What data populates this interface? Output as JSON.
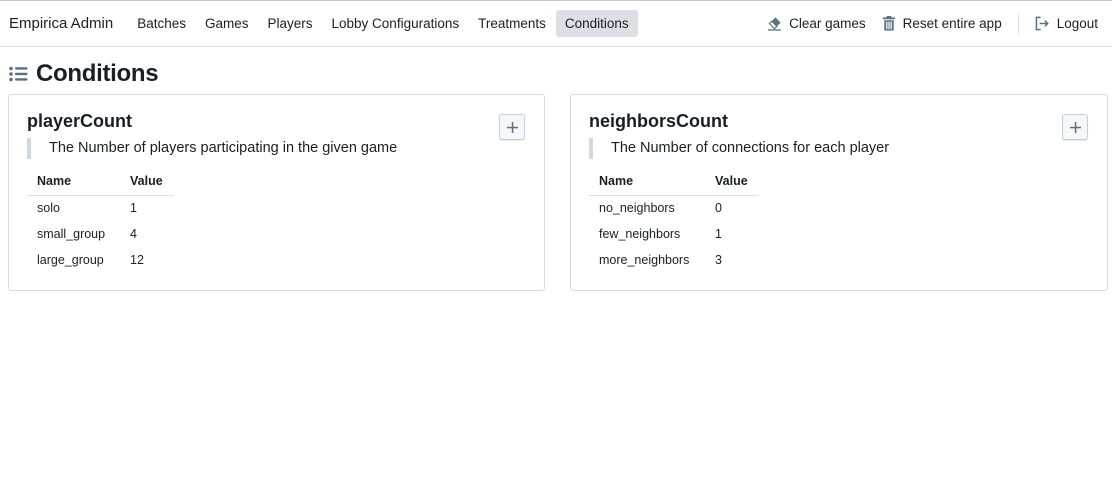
{
  "navbar": {
    "brand": "Empirica Admin",
    "tabs": [
      {
        "label": "Batches",
        "active": false
      },
      {
        "label": "Games",
        "active": false
      },
      {
        "label": "Players",
        "active": false
      },
      {
        "label": "Lobby Configurations",
        "active": false
      },
      {
        "label": "Treatments",
        "active": false
      },
      {
        "label": "Conditions",
        "active": true
      }
    ],
    "actions": {
      "clear_games": {
        "label": "Clear games",
        "icon": "eraser-icon"
      },
      "reset_app": {
        "label": "Reset entire app",
        "icon": "trash-icon"
      },
      "logout": {
        "label": "Logout",
        "icon": "log-out-icon"
      }
    }
  },
  "page": {
    "title": "Conditions",
    "icon": "properties-list-icon"
  },
  "conditions": [
    {
      "key": "playerCount",
      "description": "The Number of players participating in the given game",
      "add_button": "+",
      "columns": [
        "Name",
        "Value"
      ],
      "rows": [
        {
          "name": "solo",
          "value": "1"
        },
        {
          "name": "small_group",
          "value": "4"
        },
        {
          "name": "large_group",
          "value": "12"
        }
      ]
    },
    {
      "key": "neighborsCount",
      "description": "The Number of connections for each player",
      "add_button": "+",
      "columns": [
        "Name",
        "Value"
      ],
      "rows": [
        {
          "name": "no_neighbors",
          "value": "0"
        },
        {
          "name": "few_neighbors",
          "value": "1"
        },
        {
          "name": "more_neighbors",
          "value": "3"
        }
      ]
    }
  ],
  "colors": {
    "active_tab_bg": "#dcdfe3",
    "text": "#182026",
    "icon": "#5c7080",
    "blockquote_border": "#ced9e0"
  }
}
